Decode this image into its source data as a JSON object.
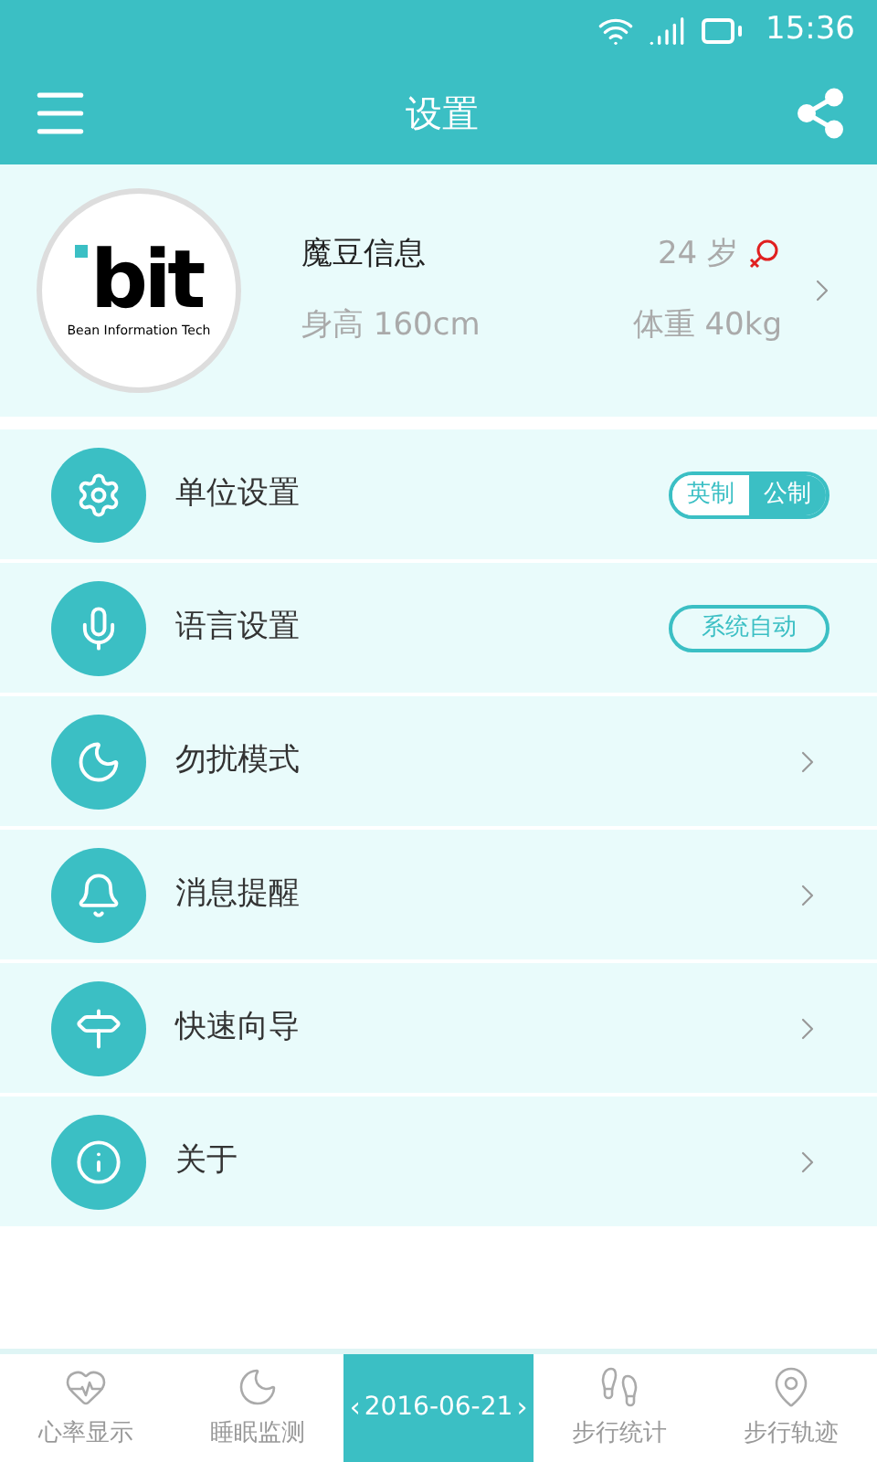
{
  "status_bar": {
    "time": "15:36"
  },
  "header": {
    "title": "设置"
  },
  "profile": {
    "logo_text": "bit",
    "logo_caption": "Bean Information Tech",
    "name": "魔豆信息",
    "age": "24 岁",
    "height": "身高 160cm",
    "weight": "体重 40kg"
  },
  "settings": [
    {
      "kind": "segmented",
      "label": "单位设置",
      "options": [
        {
          "label": "英制",
          "selected": false
        },
        {
          "label": "公制",
          "selected": true
        }
      ]
    },
    {
      "kind": "pill",
      "label": "语言设置",
      "value": "系统自动"
    },
    {
      "kind": "chevron",
      "label": "勿扰模式"
    },
    {
      "kind": "chevron",
      "label": "消息提醒"
    },
    {
      "kind": "chevron",
      "label": "快速向导"
    },
    {
      "kind": "chevron",
      "label": "关于"
    }
  ],
  "bottom_nav": [
    {
      "kind": "tab",
      "label": "心率显示"
    },
    {
      "kind": "tab",
      "label": "睡眠监测"
    },
    {
      "kind": "date",
      "prev": "‹",
      "label": "2016-06-21",
      "next": "›"
    },
    {
      "kind": "tab",
      "label": "步行统计"
    },
    {
      "kind": "tab",
      "label": "步行轨迹"
    }
  ]
}
